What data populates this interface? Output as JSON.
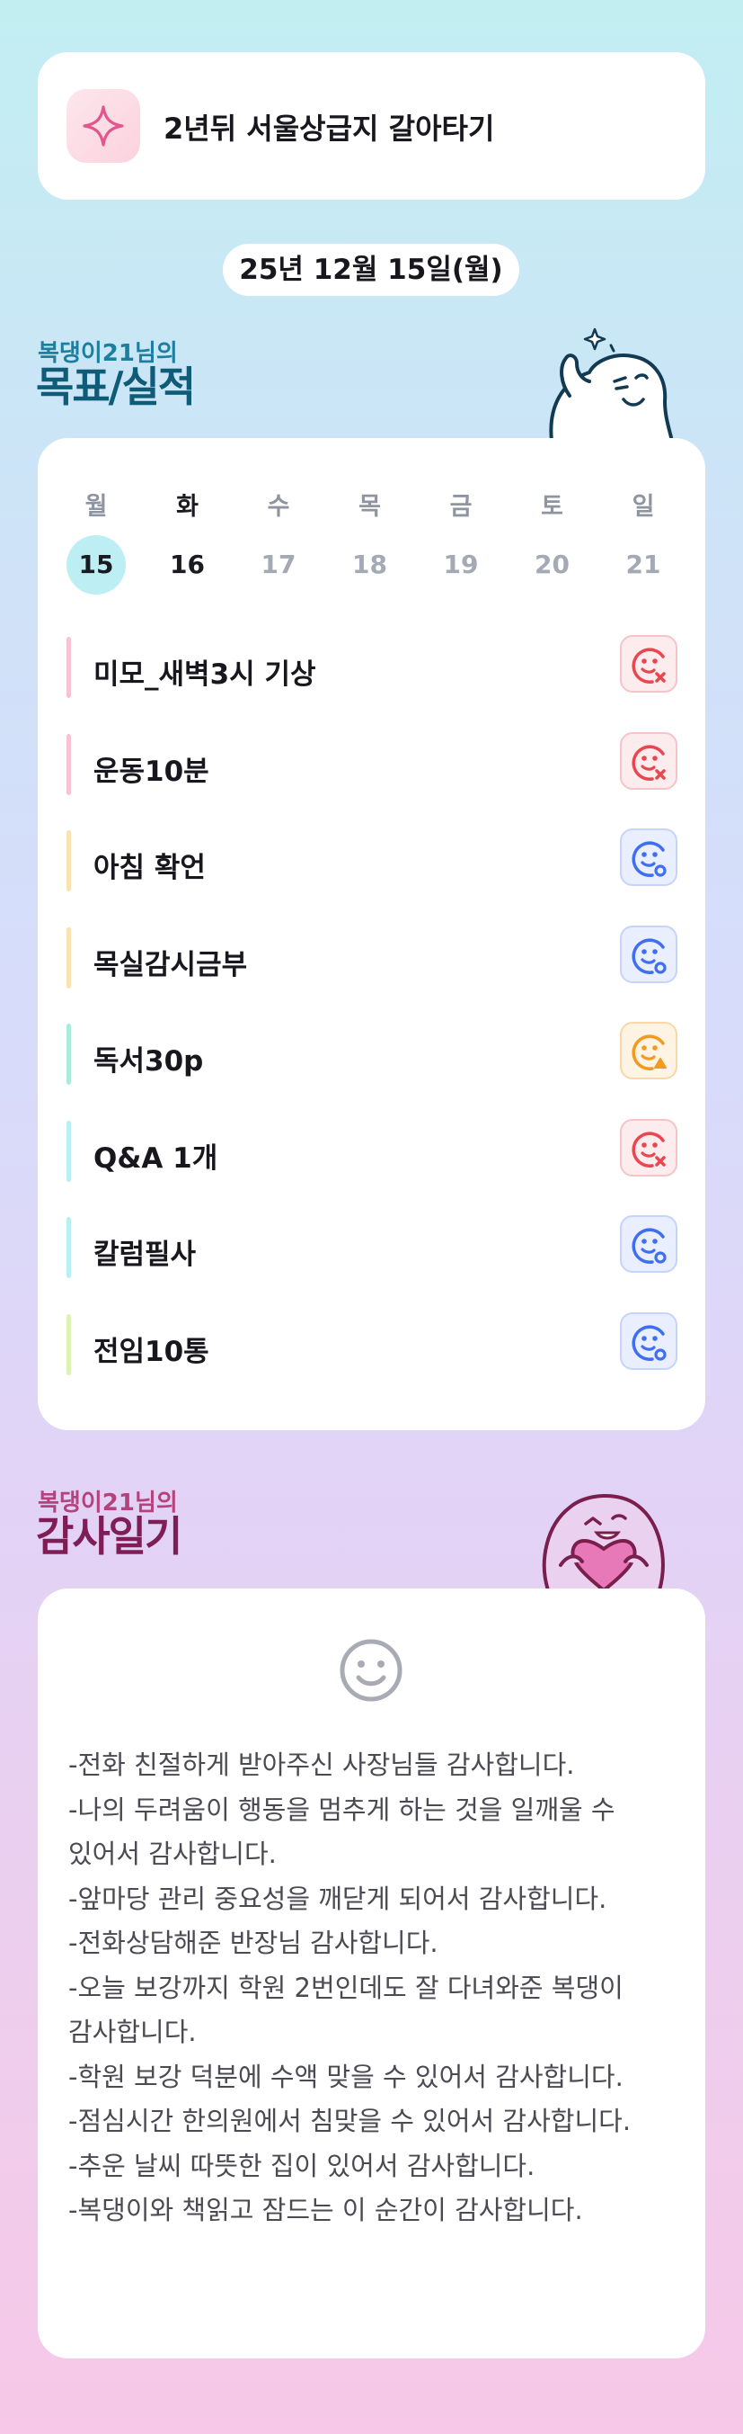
{
  "goal": {
    "title": "2년뒤 서울상급지 갈아타기",
    "icon": "sparkle-icon"
  },
  "date": "25년 12월 15일(월)",
  "goals_section": {
    "owner": "복댕이21님의",
    "title": "목표/실적"
  },
  "week": [
    {
      "name": "월",
      "date": "15",
      "today": true
    },
    {
      "name": "화",
      "date": "16",
      "bold": true
    },
    {
      "name": "수",
      "date": "17"
    },
    {
      "name": "목",
      "date": "18"
    },
    {
      "name": "금",
      "date": "19"
    },
    {
      "name": "토",
      "date": "20"
    },
    {
      "name": "일",
      "date": "21"
    }
  ],
  "goals": [
    {
      "label": "미모_새벽3시 기상",
      "bar_color": "#f7c3d4",
      "status": "fail"
    },
    {
      "label": "운동10분",
      "bar_color": "#f7c3d4",
      "status": "fail"
    },
    {
      "label": "아침 확언",
      "bar_color": "#fbe2b2",
      "status": "done"
    },
    {
      "label": "목실감시금부",
      "bar_color": "#fbe2b2",
      "status": "done"
    },
    {
      "label": "독서30p",
      "bar_color": "#a9ecdc",
      "status": "partial"
    },
    {
      "label": "Q&A 1개",
      "bar_color": "#b9eef2",
      "status": "fail"
    },
    {
      "label": "칼럼필사",
      "bar_color": "#b9eef2",
      "status": "done"
    },
    {
      "label": "전임10통",
      "bar_color": "#dff2b5",
      "status": "done"
    }
  ],
  "gratitude_section": {
    "owner": "복댕이21님의",
    "title": "감사일기",
    "icon": "smile-face-icon"
  },
  "gratitude": [
    "-전화 친절하게 받아주신 사장님들 감사합니다.",
    "-나의 두려움이 행동을 멈추게 하는 것을 일깨울 수 있어서 감사합니다.",
    "-앞마당 관리 중요성을 깨닫게 되어서 감사합니다.",
    "-전화상담해준 반장님 감사합니다.",
    "-오늘 보강까지 학원 2번인데도 잘 다녀와준 복댕이 감사합니다.",
    "-학원 보강 덕분에 수액 맞을 수 있어서 감사합니다.",
    "-점심시간 한의원에서 침맞을 수 있어서 감사합니다.",
    "-추운 날씨 따뜻한 집이 있어서 감사합니다.",
    "-복댕이와 책읽고 잠드는 이 순간이 감사합니다."
  ],
  "colors": {
    "fail": "#e9474f",
    "done": "#3f6ff0",
    "partial": "#f29a1e"
  }
}
